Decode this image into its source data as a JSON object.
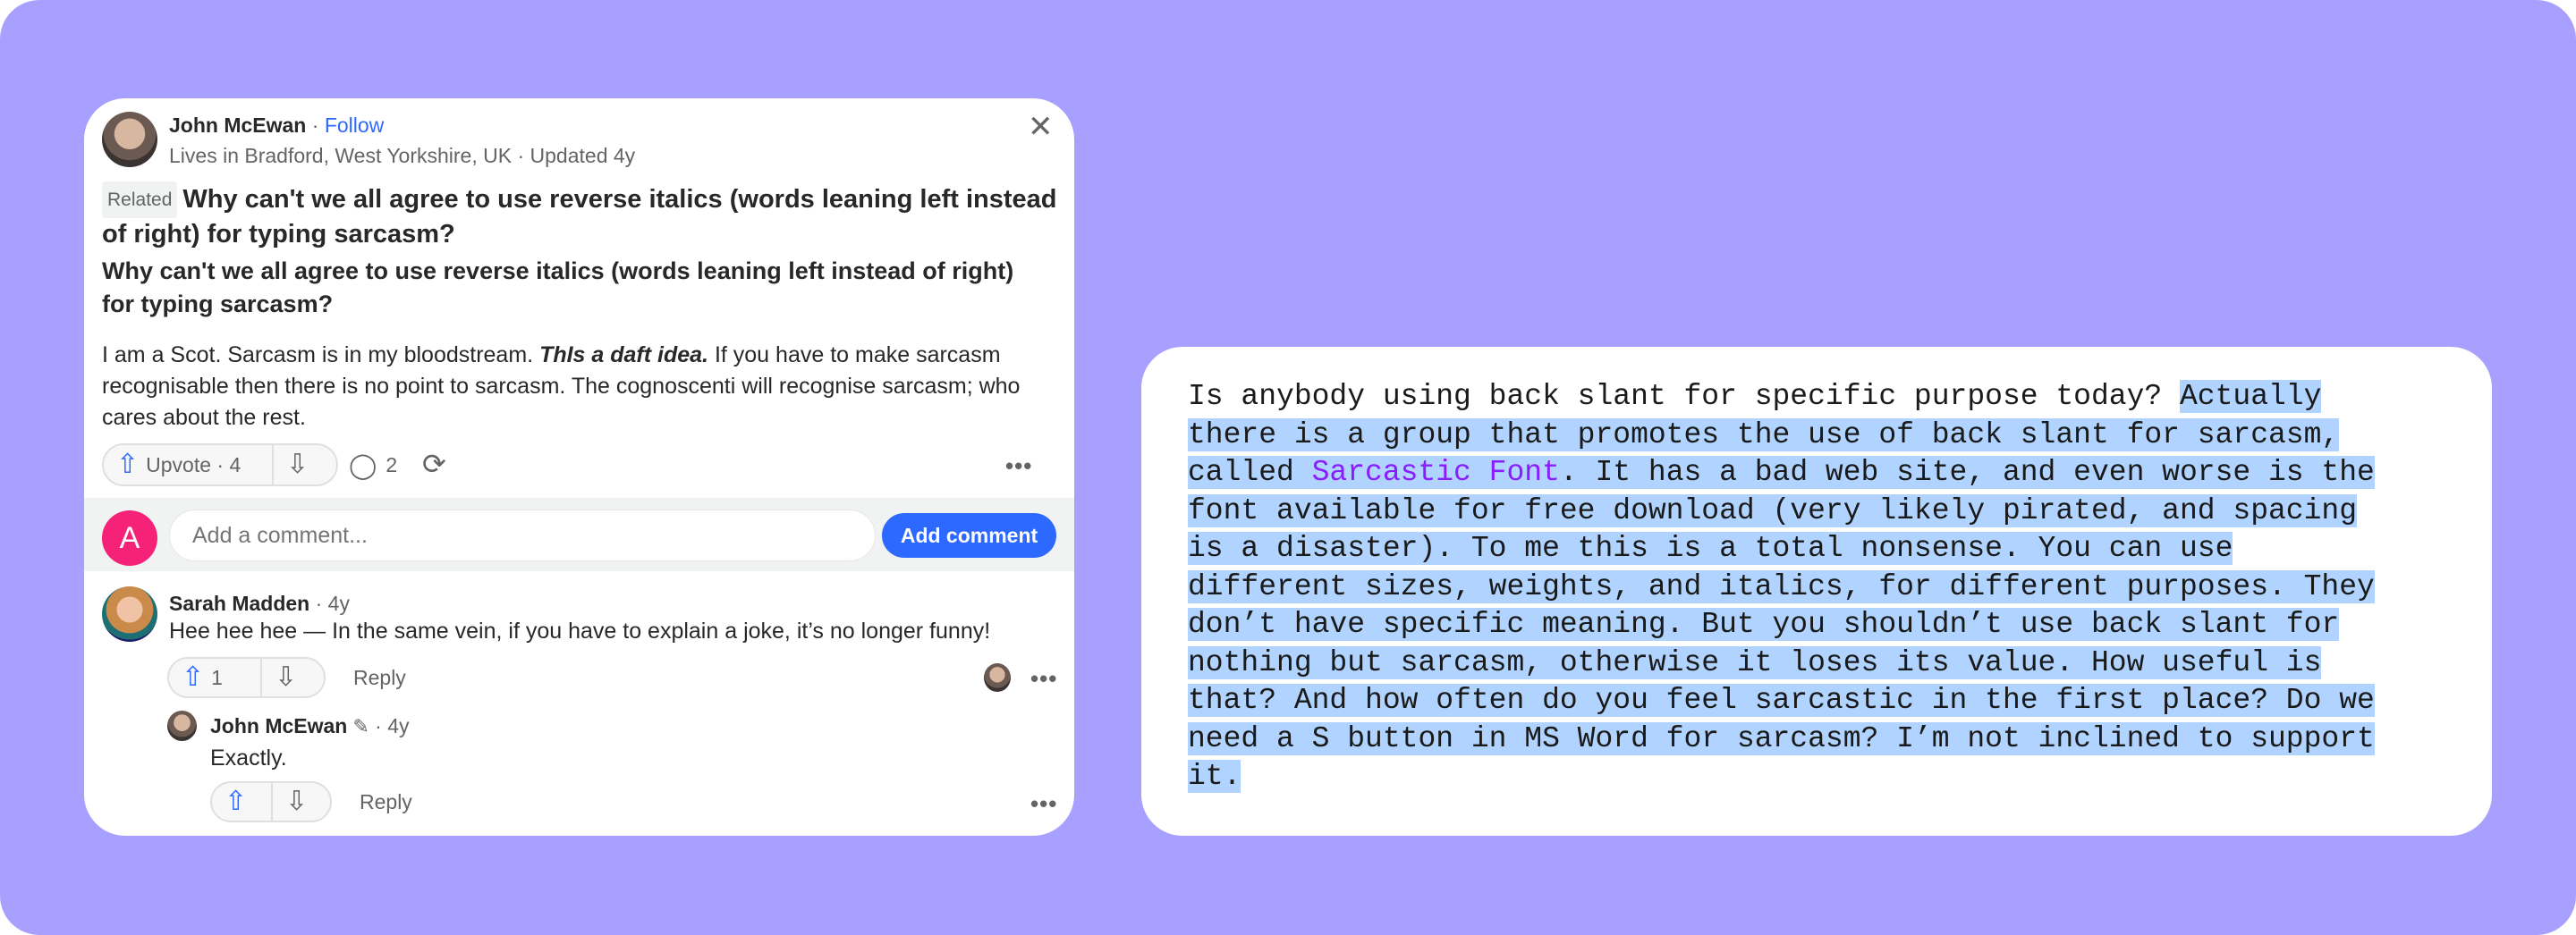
{
  "colors": {
    "background": "#a7a0ff",
    "accent": "#2e69ff",
    "selection": "#b0d4ff",
    "link": "#8a1cff",
    "avatar_pink": "#f52277"
  },
  "answer": {
    "author": "John McEwan",
    "separator": " · ",
    "follow": "Follow",
    "meta": "Lives in Bradford, West Yorkshire, UK · Updated 4y",
    "close_icon": "close-icon",
    "related_badge": "Related",
    "related_question": "Why can't we all agree to use reverse italics (words leaning left instead of right) for typing sarcasm?",
    "question": "Why can't we all agree to use reverse italics (words leaning left instead of right) for typing sarcasm?",
    "body_before": "I am a Scot. Sarcasm is in my bloodstream. ",
    "body_emphasis": "ThIs a daft idea.",
    "body_after": " If you have to make sarcasm recognisable then there is no point to sarcasm. The cognoscenti will recognise sarcasm; who cares about the rest.",
    "upvote_label": "Upvote · 4",
    "comment_count": "2",
    "more": "•••"
  },
  "comment_box": {
    "avatar_letter": "A",
    "placeholder": "Add a comment...",
    "button": "Add comment"
  },
  "comments": [
    {
      "author": "Sarah Madden",
      "time": " · 4y",
      "text": "Hee hee hee — In the same vein, if you have to explain a joke, it’s no longer funny!",
      "upvotes": "1",
      "reply": "Reply",
      "more": "•••"
    },
    {
      "author": "John McEwan",
      "time": " · 4y",
      "text": "Exactly.",
      "reply": "Reply",
      "more": "•••"
    }
  ],
  "excerpt": {
    "lines": [
      {
        "plain": "Is anybody using back slant for specific purpose today? ",
        "hl": "Actually"
      },
      {
        "hl": "there is a group that promotes the use of back slant for sarcasm,"
      },
      {
        "hl": "called ",
        "link": "Sarcastic Font",
        "after": ". It has a bad web site, and even worse is the"
      },
      {
        "hl": "font available for free download (very likely pirated, and spacing"
      },
      {
        "hl": "is a disaster). To me this is a total nonsense. You can use"
      },
      {
        "hl": "different sizes, weights, and italics, for different purposes. They"
      },
      {
        "hl": "don’t have specific meaning. But you shouldn’t use back slant for"
      },
      {
        "hl": "nothing but sarcasm, otherwise it loses its value. How useful is"
      },
      {
        "hl": "that? And how often do you feel sarcastic in the first place? Do we"
      },
      {
        "hl": "need a S button in MS Word for sarcasm? I’m not inclined to support"
      },
      {
        "hl": "it."
      }
    ]
  }
}
